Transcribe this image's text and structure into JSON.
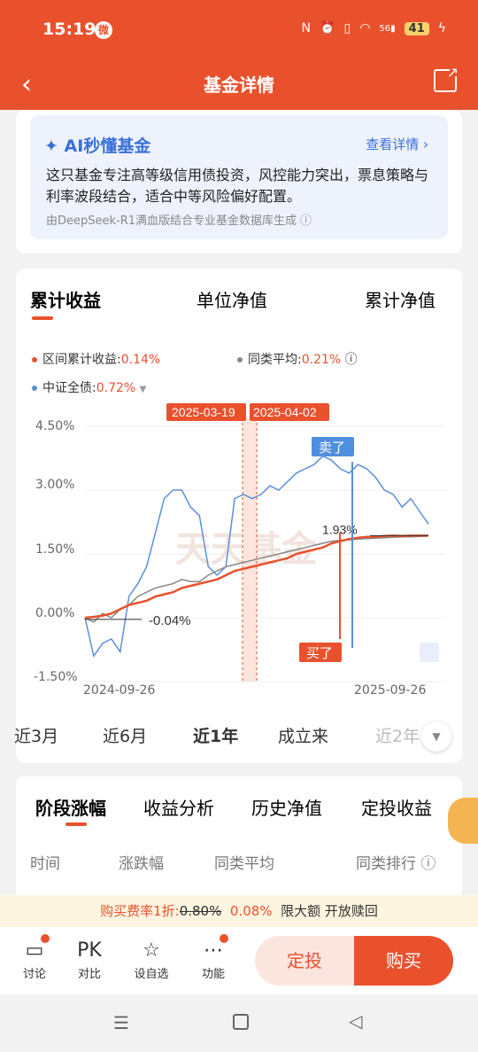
{
  "status": {
    "time": "15:19",
    "weibo": "微",
    "battery": "41",
    "network": "56",
    "icons": [
      "nfc-icon",
      "alarm-icon",
      "vibrate-icon",
      "wifi-icon",
      "signal-icon"
    ]
  },
  "nav": {
    "title": "基金详情"
  },
  "ai": {
    "title": "AI秒懂基金",
    "more": "查看详情",
    "text": "这只基金专注高等级信用债投资，风控能力突出，票息策略与利率波段结合，适合中等风险偏好配置。",
    "source": "由DeepSeek-R1满血版结合专业基金数据库生成"
  },
  "chart_tabs": [
    "累计收益",
    "单位净值",
    "累计净值"
  ],
  "legend": {
    "fund_label": "区间累计收益:",
    "fund_value": "0.14%",
    "avg_label": "同类平均:",
    "avg_value": "0.21%",
    "index_label": "中证全债:",
    "index_value": "0.72%"
  },
  "chart_data": {
    "type": "line",
    "y_ticks": [
      "4.50%",
      "3.00%",
      "1.50%",
      "0.00%",
      "-1.50%"
    ],
    "ylim": [
      -1.5,
      4.5
    ],
    "x_ticks": [
      "2024-09-26",
      "2025-09-26"
    ],
    "markers": {
      "date1": "2025-03-19",
      "date2": "2025-04-02",
      "sell": "卖了",
      "buy": "买了",
      "label_start": "-0.04%",
      "label_end": "1.93%",
      "watermark": "天天基金"
    },
    "series": [
      {
        "name": "区间累计收益",
        "color": "#e9512d",
        "values": [
          0,
          0.02,
          0.05,
          0.1,
          0.2,
          0.3,
          0.35,
          0.4,
          0.5,
          0.55,
          0.6,
          0.7,
          0.75,
          0.8,
          0.85,
          0.9,
          1.0,
          1.1,
          1.15,
          1.2,
          1.25,
          1.3,
          1.35,
          1.4,
          1.5,
          1.55,
          1.6,
          1.65,
          1.75,
          1.8,
          1.85,
          1.88,
          1.9,
          1.9,
          1.92,
          1.93,
          1.92,
          1.93,
          1.93,
          1.93
        ]
      },
      {
        "name": "同类平均",
        "color": "#888888",
        "values": [
          0,
          -0.1,
          0.1,
          0.0,
          0.2,
          0.3,
          0.5,
          0.6,
          0.7,
          0.75,
          0.8,
          0.9,
          0.85,
          0.85,
          1.0,
          1.1,
          1.2,
          1.25,
          1.3,
          1.35,
          1.4,
          1.45,
          1.5,
          1.55,
          1.6,
          1.65,
          1.7,
          1.75,
          1.8,
          1.82,
          1.83,
          1.85,
          1.86,
          1.87,
          1.88,
          1.89,
          1.9,
          1.9,
          1.91,
          1.92
        ]
      },
      {
        "name": "中证全债",
        "color": "#5b8fd9",
        "values": [
          0,
          -0.9,
          -0.6,
          -0.5,
          -0.8,
          0.5,
          0.8,
          1.2,
          2.0,
          2.8,
          3.0,
          3.0,
          2.6,
          2.4,
          1.2,
          1.0,
          1.2,
          2.8,
          2.9,
          2.8,
          2.9,
          3.1,
          3.0,
          3.2,
          3.4,
          3.5,
          3.6,
          3.8,
          3.7,
          3.5,
          3.4,
          3.6,
          3.5,
          3.3,
          3.0,
          2.9,
          2.6,
          2.8,
          2.5,
          2.2
        ]
      }
    ]
  },
  "periods": [
    "近3月",
    "近6月",
    "近1年",
    "成立来",
    "近2年"
  ],
  "stage_tabs": [
    "阶段涨幅",
    "收益分析",
    "历史净值",
    "定投收益"
  ],
  "stage_head": [
    "时间",
    "涨跌幅",
    "同类平均",
    "同类排行"
  ],
  "fee": {
    "prefix": "购买费率1折:",
    "old": "0.80%",
    "new": "0.08%",
    "suffix": "限大额 开放赎回"
  },
  "bottom": {
    "items": [
      "讨论",
      "对比",
      "设自选",
      "功能"
    ],
    "pk": "PK",
    "fixed": "定投",
    "buy": "购买"
  }
}
